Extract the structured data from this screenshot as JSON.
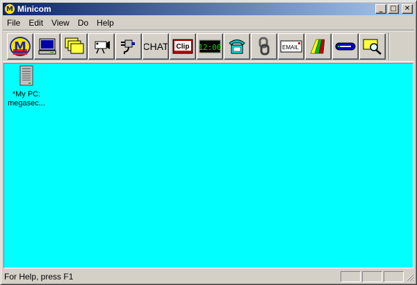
{
  "window": {
    "title": "Minicom",
    "app_icon_letter": "M"
  },
  "caption_buttons": {
    "minimize": "_",
    "maximize": "□",
    "close": "✕"
  },
  "menu": [
    "File",
    "Edit",
    "View",
    "Do",
    "Help"
  ],
  "toolbar": {
    "buttons": [
      {
        "icon": "minicom-logo-icon",
        "label": "M"
      },
      {
        "icon": "monitor-icon"
      },
      {
        "icon": "folders-icon"
      },
      {
        "icon": "video-camera-icon"
      },
      {
        "icon": "plug-icon"
      },
      {
        "icon": "chat-icon",
        "label": "CHAT"
      },
      {
        "icon": "clip-icon",
        "label": "Clip"
      },
      {
        "icon": "clock-icon",
        "label": "12:00"
      },
      {
        "icon": "phone-icon"
      },
      {
        "icon": "chain-link-icon"
      },
      {
        "icon": "email-icon",
        "label": "EMAIL"
      },
      {
        "icon": "paint-icon"
      },
      {
        "icon": "modem-icon"
      },
      {
        "icon": "folder-search-icon"
      }
    ]
  },
  "colors": {
    "client_background": "#00ffff",
    "title_gradient_start": "#0a246a",
    "title_gradient_end": "#a6caf0",
    "face": "#d4d0c8"
  },
  "devices": [
    {
      "icon": "computer-tower-icon",
      "label": "*My PC:\nmegasec..."
    }
  ],
  "status": {
    "text": "For Help, press F1"
  }
}
